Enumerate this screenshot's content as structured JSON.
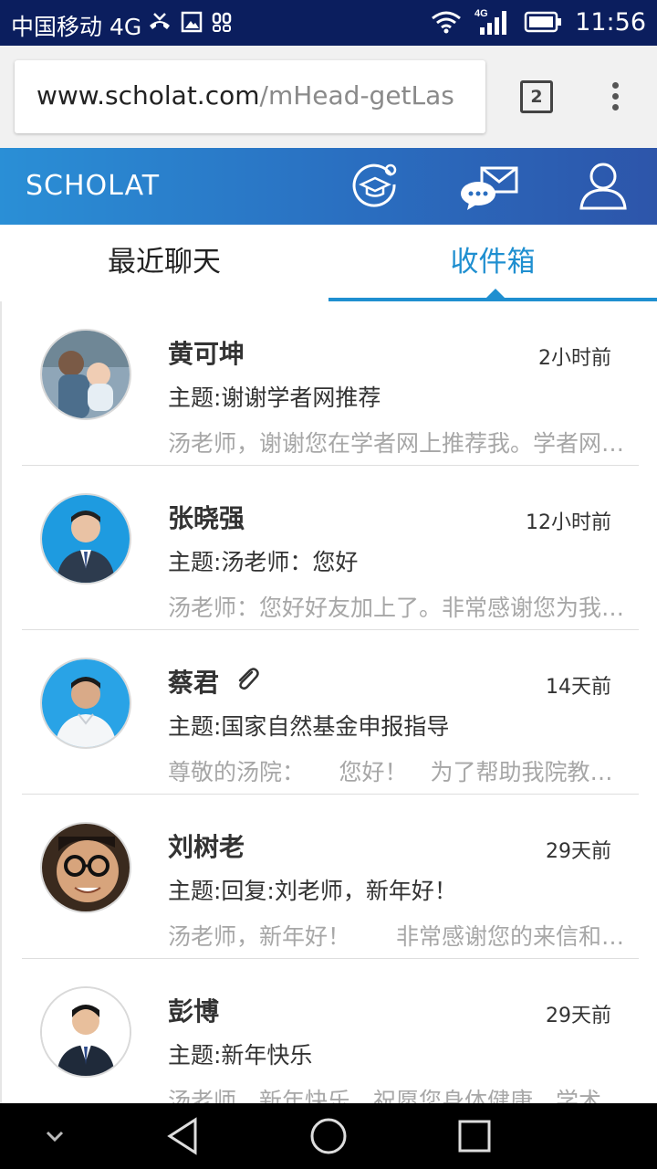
{
  "status_bar": {
    "carrier": "中国移动 4G",
    "network_badge": "4G",
    "time": "11:56"
  },
  "browser": {
    "url_host": "www.scholat.com",
    "url_path": "/mHead-getLas",
    "tab_count": "2"
  },
  "app": {
    "brand": "SCHOLAT"
  },
  "tabs": [
    {
      "label": "最近聊天",
      "active": false
    },
    {
      "label": "收件箱",
      "active": true
    }
  ],
  "messages": [
    {
      "name": "黄可坤",
      "time": "2小时前",
      "subject": "主题:谢谢学者网推荐",
      "preview": "汤老师，谢谢您在学者网上推荐我。学者网上推荐我。",
      "attachment": false,
      "avatar": "photo-family"
    },
    {
      "name": "张晓强",
      "time": "12小时前",
      "subject": "主题:汤老师：您好",
      "preview": "汤老师：您好好友加上了。非常感谢您为我的工作提供帮助",
      "attachment": false,
      "avatar": "photo-suit-blue"
    },
    {
      "name": "蔡君",
      "time": "14天前",
      "subject": "主题:国家自然基金申报指导",
      "preview": "尊敬的汤院：　　您好！　为了帮助我院教师申报",
      "attachment": true,
      "avatar": "photo-shirt-blue"
    },
    {
      "name": "刘树老",
      "time": "29天前",
      "subject": "主题:回复:刘老师，新年好！",
      "preview": "汤老师，新年好！　　非常感谢您的来信和祝福",
      "attachment": false,
      "avatar": "photo-glasses"
    },
    {
      "name": "彭博",
      "time": "29天前",
      "subject": "主题:新年快乐",
      "preview": "汤老师，新年快乐，祝愿您身体健康，学术进步",
      "attachment": false,
      "avatar": "photo-suit-white"
    }
  ]
}
